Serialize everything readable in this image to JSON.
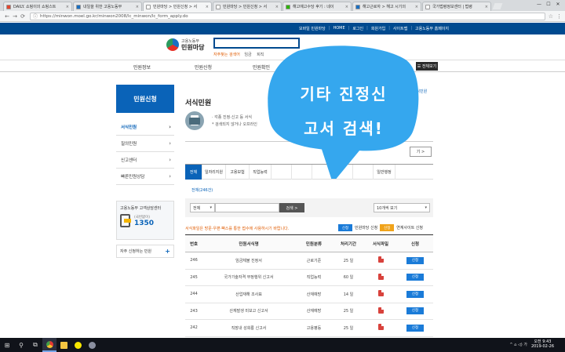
{
  "browser": {
    "tabs": [
      {
        "title": "DAILY. 쇼핑이의 쇼핑스트",
        "fav": "#e3462f",
        "active": false
      },
      {
        "title": "내일을 위한 고용노동부",
        "fav": "#1a6fc2",
        "active": false
      },
      {
        "title": "민원마당 > 민원신청 > 서",
        "fav": "#ffffff",
        "active": true
      },
      {
        "title": "민원마당 > 민원신청 > 서",
        "fav": "#ffffff",
        "active": false
      },
      {
        "title": "해고예고수당 후기 : 네이",
        "fav": "#2db400",
        "active": false
      },
      {
        "title": "해고근로자 > 해고 시기의",
        "fav": "#1a6fc2",
        "active": false
      },
      {
        "title": "국가법령정보센터 | 법령",
        "fav": "#ffffff",
        "active": false
      }
    ],
    "url": "https://minwon.moel.go.kr/minwon2008/lc_minwon/lc_form_apply.do",
    "secure_label": "ⓘ",
    "min_icon": "—",
    "max_icon": "☐",
    "close_icon": "✕",
    "back_icon": "←",
    "fwd_icon": "→",
    "reload_icon": "⟳",
    "star_icon": "☆",
    "menu_icon": "⋮"
  },
  "util": {
    "links": [
      "모바일 민원마당",
      "HOME",
      "로그인",
      "회원가입",
      "사이트맵",
      "고용노동부 홈페이지"
    ]
  },
  "header": {
    "logo_small": "고용노동부",
    "logo_big": "민원마당",
    "hot_label": "자주찾는 검색어",
    "hot_words": [
      "임금",
      "퇴직"
    ]
  },
  "gnb": {
    "items": [
      "민원정보",
      "민원신청",
      "민원확인"
    ],
    "all_label": "☰ 전체보기"
  },
  "lnb": {
    "title": "민원신청",
    "items": [
      {
        "label": "서식민원",
        "active": true
      },
      {
        "label": "질의민원",
        "active": false
      },
      {
        "label": "신고센터",
        "active": false
      },
      {
        "label": "빠른민원상담",
        "active": false
      }
    ],
    "callcenter_title": "고용노동부 고객상담센터",
    "callcenter_sub": "(국번없이)",
    "callcenter_num": "1350",
    "freq_label": "자주 신청하는 민원"
  },
  "content": {
    "title": "서식민원",
    "breadcrumb": "> 서식민원",
    "intro": [
      "· 각종 진정·신고 등 서식",
      "* 검색되지 않거나 오프라인"
    ],
    "more_label": "기 >",
    "tabs": [
      "전체",
      "일자리지원",
      "고용보험",
      "직업능력",
      "",
      "",
      "",
      "",
      "",
      "일반행정"
    ],
    "sub_tab": "전체(246건)",
    "filter_select": "전체",
    "search_btn": "검색 >",
    "page_size": "10개씩 보기",
    "notice": "서식파일은 방문·우편·팩스를 통한 접수에 사용하시기 바랍니다.",
    "legend": [
      {
        "badge": "신청",
        "color": "blue",
        "label": "민원마당 신청"
      },
      {
        "badge": "신청",
        "color": "orange",
        "label": "연계사이트 신청"
      }
    ]
  },
  "table": {
    "headers": [
      "번호",
      "민원서식명",
      "민원분류",
      "처리기간",
      "서식파일",
      "신청"
    ],
    "rows": [
      {
        "no": "246",
        "name": "임금체불 진정서",
        "cat": "근로기준",
        "days": "25 일",
        "apply": "신청"
      },
      {
        "no": "245",
        "name": "국가기술자격 부정행위 신고서",
        "cat": "직업능력",
        "days": "60 일",
        "apply": "신청"
      },
      {
        "no": "244",
        "name": "산업재해 조사표",
        "cat": "산재예방",
        "days": "14 일",
        "apply": "신청"
      },
      {
        "no": "243",
        "name": "산재발생 미보고 신고서",
        "cat": "산재예방",
        "days": "25 일",
        "apply": "신청"
      },
      {
        "no": "242",
        "name": "직장내 성희롱 신고서",
        "cat": "고용평등",
        "days": "25 일",
        "apply": "신청"
      }
    ]
  },
  "overlay": {
    "line1": "기타 진정신",
    "line2": "고서 검색!",
    "color": "#35a7ee"
  },
  "taskbar": {
    "start_icon": "⊞",
    "search_icon": "⚲",
    "taskview_icon": "⧉",
    "time": "오전 9:43",
    "date": "2019-02-26",
    "tray": "^ ⌂ ◁) 가"
  }
}
